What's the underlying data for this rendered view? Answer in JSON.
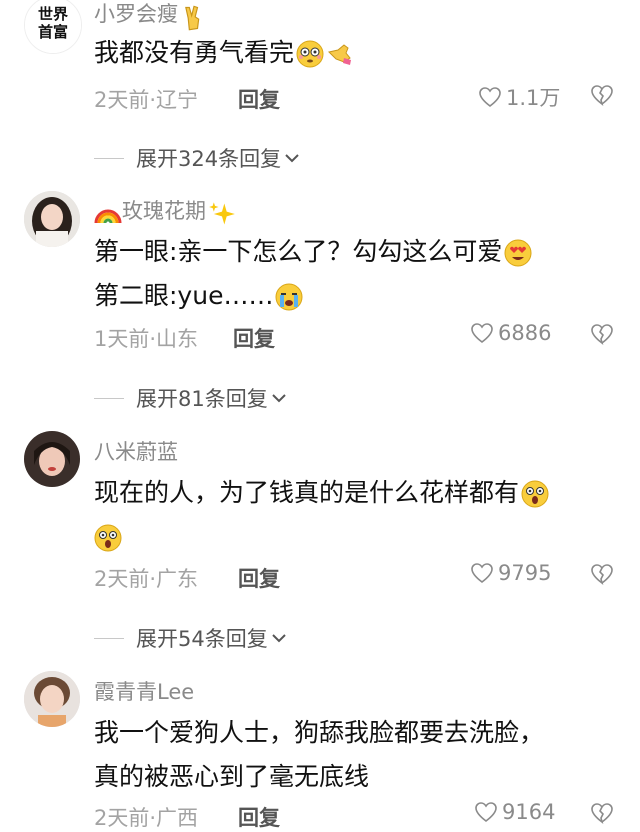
{
  "comments": [
    {
      "avatar_text": [
        "世界",
        "首富"
      ],
      "username": "小罗会瘦",
      "lines": [
        "我都没有勇气看完"
      ],
      "time_location": "2天前·辽宁",
      "reply_label": "回复",
      "likes": "1.1万",
      "expand_label": "展开324条回复"
    },
    {
      "username": "玫瑰花期",
      "lines": [
        "第一眼:亲一下怎么了？勾勾这么可爱",
        "第二眼:yue……"
      ],
      "time_location": "1天前·山东",
      "reply_label": "回复",
      "likes": "6886",
      "expand_label": "展开81条回复"
    },
    {
      "username": "八米蔚蓝",
      "lines": [
        "现在的人，为了钱真的是什么花样都有",
        ""
      ],
      "time_location": "2天前·广东",
      "reply_label": "回复",
      "likes": "9795",
      "expand_label": "展开54条回复"
    },
    {
      "username": "霞青青Lee",
      "lines": [
        "我一个爱狗人士，狗舔我脸都要去洗脸，",
        "真的被恶心到了毫无底线"
      ],
      "time_location": "2天前·广西",
      "reply_label": "回复",
      "likes": "9164"
    }
  ],
  "icons": {
    "like": "heart-outline-icon",
    "dislike": "broken-heart-icon",
    "expand": "chevron-down-icon"
  },
  "colors": {
    "username": "#8a8a8a",
    "text": "#111111",
    "meta": "#a3a3a3"
  }
}
